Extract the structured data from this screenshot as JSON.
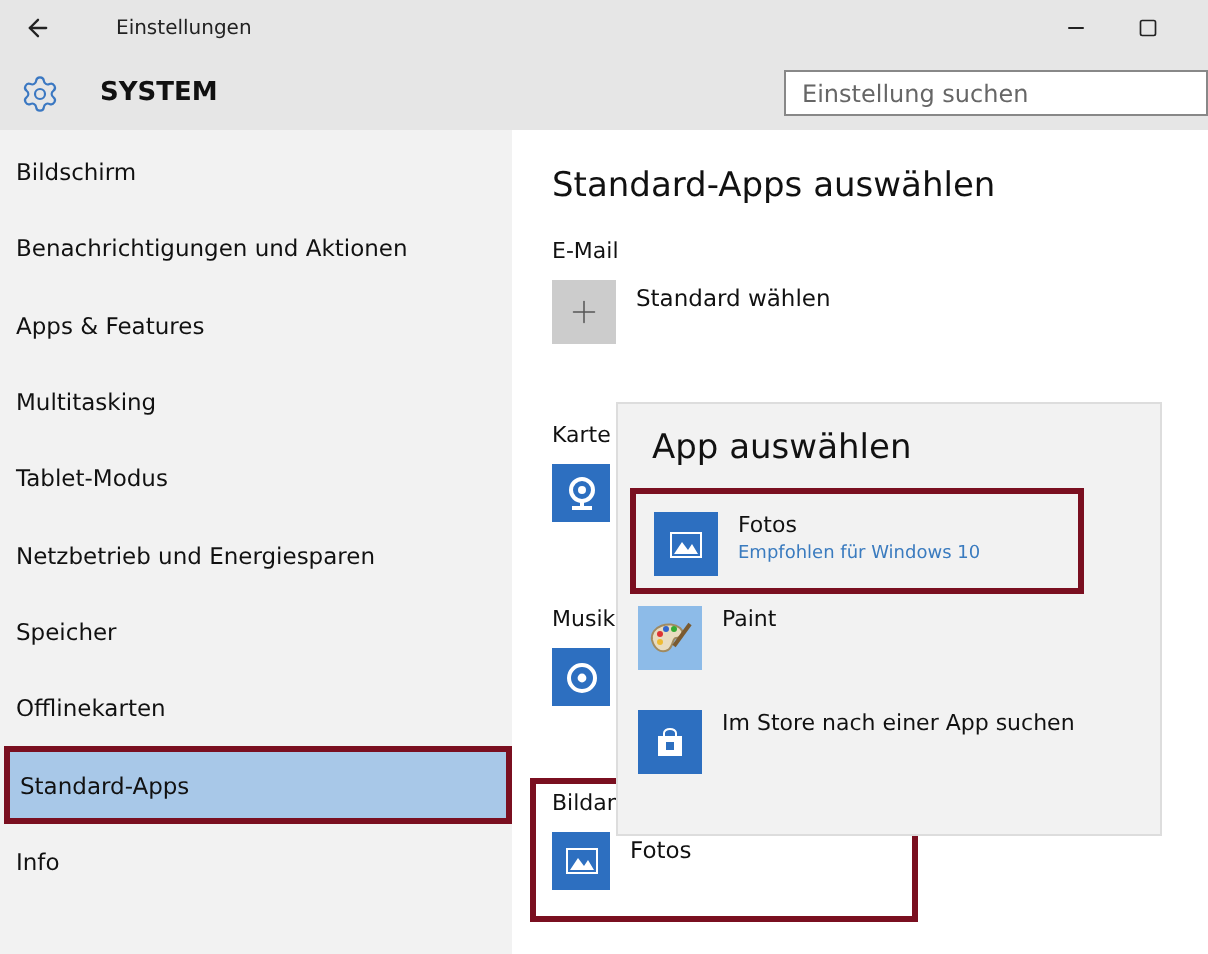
{
  "window": {
    "title": "Einstellungen"
  },
  "header": {
    "title": "SYSTEM",
    "search": {
      "placeholder": "Einstellung suchen"
    }
  },
  "sidebar": {
    "items": [
      {
        "label": "Bildschirm",
        "selected": false,
        "highlighted": false
      },
      {
        "label": "Benachrichtigungen und Aktionen",
        "selected": false,
        "highlighted": false
      },
      {
        "label": "Apps & Features",
        "selected": false,
        "highlighted": false
      },
      {
        "label": "Multitasking",
        "selected": false,
        "highlighted": false
      },
      {
        "label": "Tablet-Modus",
        "selected": false,
        "highlighted": false
      },
      {
        "label": "Netzbetrieb und Energiesparen",
        "selected": false,
        "highlighted": false
      },
      {
        "label": "Speicher",
        "selected": false,
        "highlighted": false
      },
      {
        "label": "Offlinekarten",
        "selected": false,
        "highlighted": false
      },
      {
        "label": "Standard-Apps",
        "selected": true,
        "highlighted": true
      },
      {
        "label": "Info",
        "selected": false,
        "highlighted": false
      }
    ]
  },
  "content": {
    "heading": "Standard-Apps auswählen",
    "sections": [
      {
        "label": "E-Mail",
        "app": {
          "kind": "add",
          "name": "Standard wählen"
        },
        "highlighted": false
      },
      {
        "label": "Karte",
        "app": {
          "kind": "maps"
        },
        "highlighted": false
      },
      {
        "label": "Musik",
        "app": {
          "kind": "music"
        },
        "highlighted": false
      },
      {
        "label": "Bildan",
        "app": {
          "kind": "photos",
          "name": "Fotos"
        },
        "highlighted": true
      }
    ]
  },
  "popup": {
    "title": "App auswählen",
    "options": [
      {
        "kind": "photos",
        "name": "Fotos",
        "subtitle": "Empfohlen für Windows 10",
        "highlighted": true
      },
      {
        "kind": "paint",
        "name": "Paint",
        "highlighted": false
      },
      {
        "kind": "store",
        "name": "Im Store nach einer App suchen",
        "highlighted": false
      }
    ]
  }
}
